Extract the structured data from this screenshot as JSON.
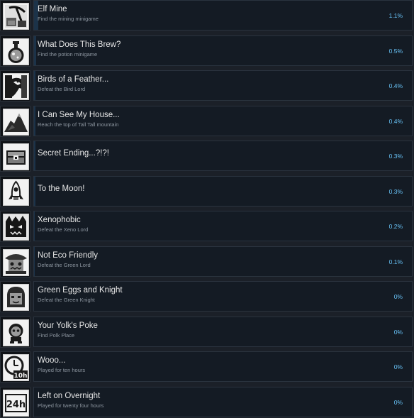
{
  "achievements": [
    {
      "title": "Elf Mine",
      "desc": "Find the mining minigame",
      "percent": "1.1%",
      "progress": 0.011,
      "icon": "pickaxe-icon"
    },
    {
      "title": "What Does This Brew?",
      "desc": "Find the potion minigame",
      "percent": "0.5%",
      "progress": 0.005,
      "icon": "potion-icon"
    },
    {
      "title": "Birds of a Feather...",
      "desc": "Defeat the Bird Lord",
      "percent": "0.4%",
      "progress": 0.004,
      "icon": "bird-icon"
    },
    {
      "title": "I Can See My House...",
      "desc": "Reach the top of Tall Tall mountain",
      "percent": "0.4%",
      "progress": 0.004,
      "icon": "mountain-icon"
    },
    {
      "title": "Secret Ending...?!?!",
      "desc": "",
      "percent": "0.3%",
      "progress": 0.003,
      "icon": "chest-icon"
    },
    {
      "title": "To the Moon!",
      "desc": "",
      "percent": "0.3%",
      "progress": 0.003,
      "icon": "rocket-icon"
    },
    {
      "title": "Xenophobic",
      "desc": "Defeat the Xeno Lord",
      "percent": "0.2%",
      "progress": 0.002,
      "icon": "xeno-icon"
    },
    {
      "title": "Not Eco Friendly",
      "desc": "Defeat the Green Lord",
      "percent": "0.1%",
      "progress": 0.001,
      "icon": "green-lord-icon"
    },
    {
      "title": "Green Eggs and Knight",
      "desc": "Defeat the Green Knight",
      "percent": "0%",
      "progress": 0,
      "icon": "green-knight-icon"
    },
    {
      "title": "Your Yolk's Poke",
      "desc": "Find Polk Place",
      "percent": "0%",
      "progress": 0,
      "icon": "egg-creature-icon"
    },
    {
      "title": "Wooo...",
      "desc": "Played for ten hours",
      "percent": "0%",
      "progress": 0,
      "icon": "clock-10h-icon",
      "icon_text": "10h"
    },
    {
      "title": "Left on Overnight",
      "desc": "Played for twenty four hours",
      "percent": "0%",
      "progress": 0,
      "icon": "badge-24h-icon",
      "icon_text": "24h"
    }
  ]
}
